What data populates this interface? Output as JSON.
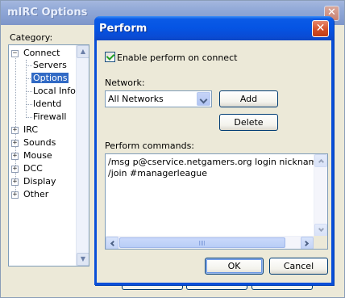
{
  "background_window": {
    "title": "mIRC Options",
    "close_glyph": "✕",
    "category_label": "Category:",
    "tree": [
      {
        "label": "Connect",
        "expander": "−",
        "children": [
          {
            "label": "Servers"
          },
          {
            "label": "Options",
            "selected": true
          },
          {
            "label": "Local Info"
          },
          {
            "label": "Identd"
          },
          {
            "label": "Firewall"
          }
        ]
      },
      {
        "label": "IRC",
        "expander": "+"
      },
      {
        "label": "Sounds",
        "expander": "+"
      },
      {
        "label": "Mouse",
        "expander": "+"
      },
      {
        "label": "DCC",
        "expander": "+"
      },
      {
        "label": "Display",
        "expander": "+"
      },
      {
        "label": "Other",
        "expander": "+"
      }
    ]
  },
  "dialog": {
    "title": "Perform",
    "close_glyph": "✕",
    "enable_label": "Enable perform on connect",
    "enable_checked": true,
    "network_label": "Network:",
    "network_value": "All Networks",
    "add_label": "Add",
    "delete_label": "Delete",
    "commands_label": "Perform commands:",
    "commands_lines": [
      "/msg p@cservice.netgamers.org login nickname Pass",
      "/join #managerleague"
    ],
    "ok_label": "OK",
    "cancel_label": "Cancel"
  },
  "colors": {
    "active_title": "#0554e3",
    "inactive_title": "#8ea6d6",
    "selection": "#316ac5",
    "dialog_face": "#ece9d8"
  },
  "icons": {
    "close": "close-icon",
    "checkbox": "checkmark-icon",
    "dropdown": "chevron-down-icon"
  }
}
